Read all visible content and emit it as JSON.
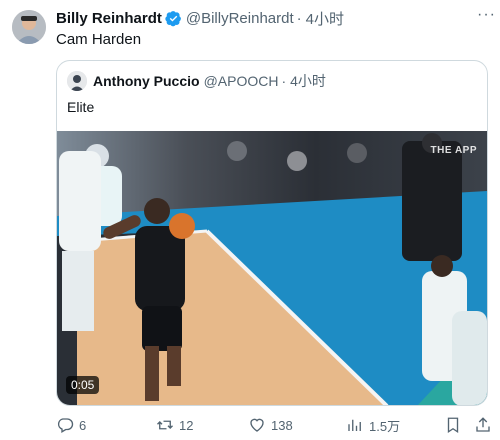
{
  "tweet": {
    "author_name": "Billy Reinhardt",
    "author_handle": "@BillyReinhardt",
    "separator": "·",
    "time": "4小时",
    "text": "Cam Harden",
    "more_icon": "more-dots-icon",
    "verified_color": "#1d9bf0"
  },
  "quote": {
    "author_name": "Anthony Puccio",
    "author_handle": "@APOOCH",
    "separator": "·",
    "time": "4小时",
    "text": "Elite",
    "video": {
      "duration": "0:05",
      "watermark": "THE APP"
    }
  },
  "actions": {
    "reply_count": "6",
    "retweet_count": "12",
    "like_count": "138",
    "views_count": "1.5万",
    "icons": [
      "reply-icon",
      "retweet-icon",
      "like-icon",
      "views-icon",
      "bookmark-icon",
      "share-icon"
    ]
  },
  "colors": {
    "text_primary": "#0f1419",
    "text_secondary": "#536471",
    "border": "#cfd9de"
  }
}
